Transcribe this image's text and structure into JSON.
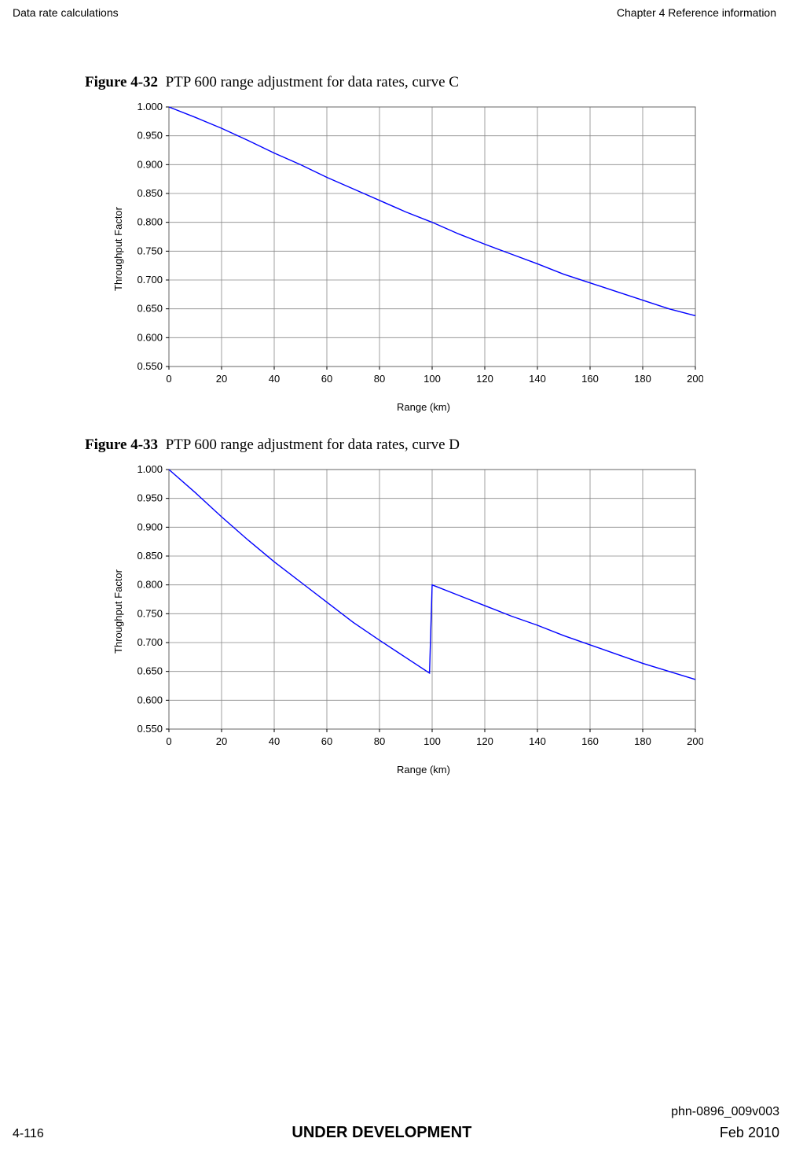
{
  "header": {
    "left": "Data rate calculations",
    "right": "Chapter 4 Reference information"
  },
  "figures": [
    {
      "label": "Figure 4-32",
      "title": "PTP 600 range adjustment for data rates, curve C",
      "ylabel": "Throughput Factor",
      "xlabel": "Range (km)"
    },
    {
      "label": "Figure 4-33",
      "title": "PTP 600 range adjustment for data rates, curve D",
      "ylabel": "Throughput Factor",
      "xlabel": "Range (km)"
    }
  ],
  "footer": {
    "doc_id": "phn-0896_009v003",
    "page": "4-116",
    "status": "UNDER DEVELOPMENT",
    "date": "Feb 2010"
  },
  "chart_data": [
    {
      "type": "line",
      "title": "PTP 600 range adjustment for data rates, curve C",
      "xlabel": "Range (km)",
      "ylabel": "Throughput Factor",
      "xlim": [
        0,
        200
      ],
      "ylim": [
        0.55,
        1.0
      ],
      "xticks": [
        0,
        20,
        40,
        60,
        80,
        100,
        120,
        140,
        160,
        180,
        200
      ],
      "yticks": [
        0.55,
        0.6,
        0.65,
        0.7,
        0.75,
        0.8,
        0.85,
        0.9,
        0.95,
        1.0
      ],
      "series": [
        {
          "name": "Curve C",
          "color": "#0000ff",
          "x": [
            0,
            10,
            20,
            30,
            40,
            50,
            60,
            70,
            80,
            90,
            100,
            110,
            120,
            130,
            140,
            150,
            160,
            170,
            180,
            190,
            200
          ],
          "y": [
            1.0,
            0.982,
            0.963,
            0.942,
            0.92,
            0.9,
            0.878,
            0.858,
            0.838,
            0.818,
            0.8,
            0.78,
            0.762,
            0.745,
            0.728,
            0.71,
            0.695,
            0.68,
            0.665,
            0.65,
            0.638
          ]
        }
      ]
    },
    {
      "type": "line",
      "title": "PTP 600 range adjustment for data rates, curve D",
      "xlabel": "Range (km)",
      "ylabel": "Throughput Factor",
      "xlim": [
        0,
        200
      ],
      "ylim": [
        0.55,
        1.0
      ],
      "xticks": [
        0,
        20,
        40,
        60,
        80,
        100,
        120,
        140,
        160,
        180,
        200
      ],
      "yticks": [
        0.55,
        0.6,
        0.65,
        0.7,
        0.75,
        0.8,
        0.85,
        0.9,
        0.95,
        1.0
      ],
      "series": [
        {
          "name": "Curve D",
          "color": "#0000ff",
          "x": [
            0,
            10,
            20,
            30,
            40,
            50,
            60,
            70,
            80,
            90,
            99,
            100,
            110,
            120,
            130,
            140,
            150,
            160,
            170,
            180,
            190,
            200
          ],
          "y": [
            1.0,
            0.96,
            0.918,
            0.878,
            0.84,
            0.805,
            0.77,
            0.735,
            0.704,
            0.674,
            0.647,
            0.8,
            0.782,
            0.764,
            0.746,
            0.73,
            0.712,
            0.696,
            0.68,
            0.664,
            0.65,
            0.636
          ]
        }
      ]
    }
  ]
}
